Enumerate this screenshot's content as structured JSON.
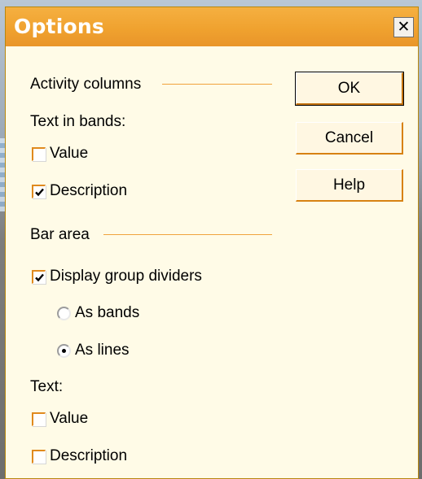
{
  "dialog": {
    "title": "Options",
    "close_glyph": "✕"
  },
  "activity_columns": {
    "heading": "Activity columns",
    "text_in_bands_label": "Text in bands:",
    "value_label": "Value",
    "value_checked": false,
    "description_label": "Description",
    "description_checked": true
  },
  "bar_area": {
    "heading": "Bar area",
    "display_group_dividers_label": "Display group dividers",
    "display_group_dividers_checked": true,
    "as_bands_label": "As bands",
    "as_lines_label": "As lines",
    "selected_option": "As lines",
    "text_label": "Text:",
    "text_value_label": "Value",
    "text_value_checked": false,
    "text_description_label": "Description",
    "text_description_checked": false
  },
  "buttons": {
    "ok": "OK",
    "cancel": "Cancel",
    "help": "Help"
  },
  "colors": {
    "title_bar": "#f0a22f",
    "dialog_bg": "#fffbe7",
    "separator": "#f0a33c",
    "box_border": "#e08a1e"
  }
}
